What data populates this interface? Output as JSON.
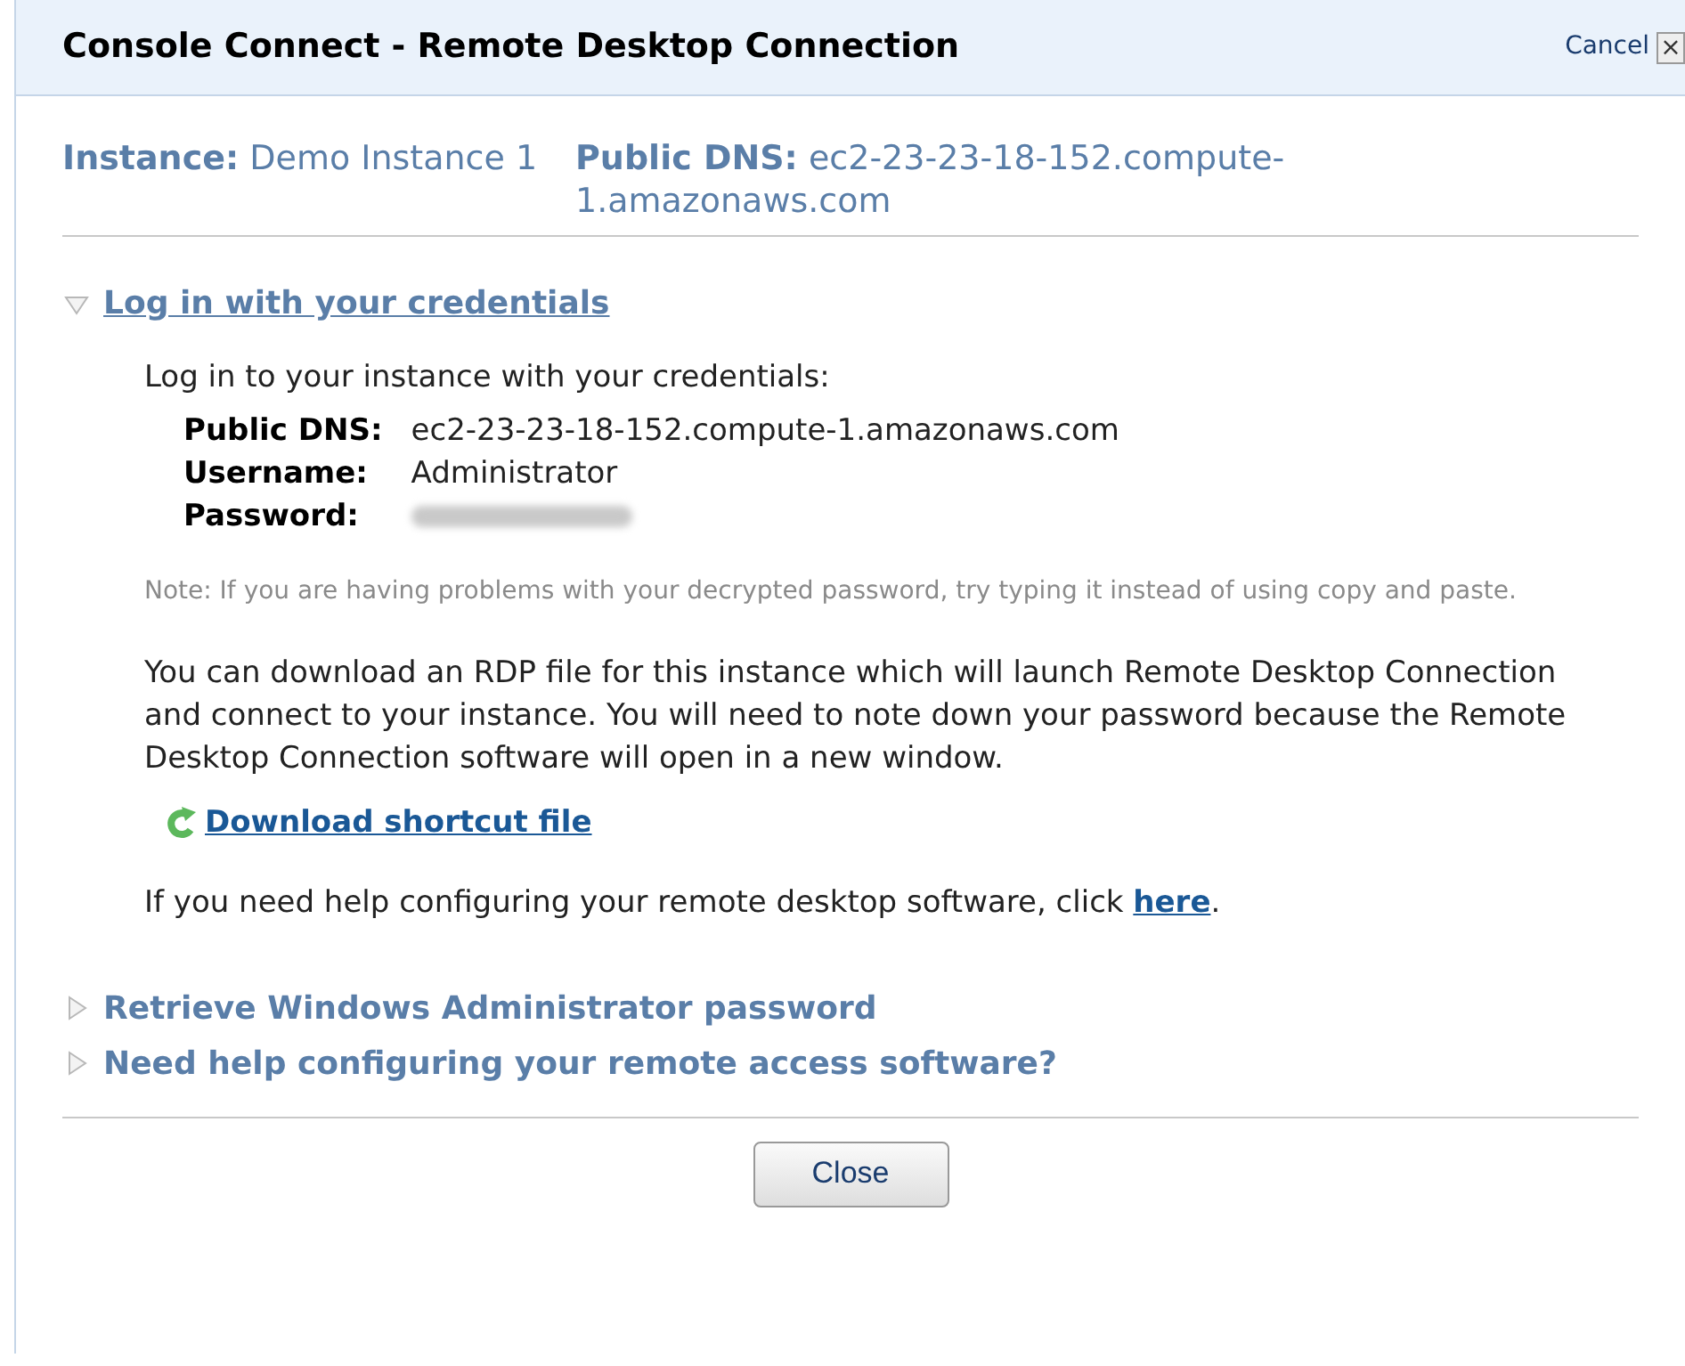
{
  "window": {
    "title": "Console Connect - Remote Desktop Connection",
    "cancel": "Cancel",
    "close_glyph": "×"
  },
  "info": [
    {
      "label": "Instance:",
      "value": "Demo Instance 1"
    },
    {
      "label": "Public DNS:",
      "value": "ec2-23-23-18-152.compute-1.amazonaws.com"
    }
  ],
  "sections": [
    {
      "title": "Log in with your credentials",
      "expanded": true,
      "intro": "Log in to your instance with your credentials:",
      "fields": [
        {
          "label": "Public DNS:",
          "value": "ec2-23-23-18-152.compute-1.amazonaws.com",
          "kind": "text"
        },
        {
          "label": "Username:",
          "value": "Administrator",
          "kind": "text"
        },
        {
          "label": "Password:",
          "kind": "redacted"
        }
      ],
      "note": "Note: If you are having problems with your decrypted password, try typing it instead of using copy and paste.",
      "description": "You can download an RDP file for this instance which will launch Remote Desktop Connection and connect to your instance. You will need to note down your password because the Remote Desktop Connection software will open in a new window.",
      "download_link": "Download shortcut file",
      "help_text": "If you need help configuring your remote desktop software, click",
      "help_link": "here",
      "help_end": "."
    },
    {
      "title": "Retrieve Windows Administrator password",
      "expanded": false
    },
    {
      "title": "Need help configuring your remote access software?",
      "expanded": false
    }
  ],
  "buttons": [
    "Close"
  ]
}
